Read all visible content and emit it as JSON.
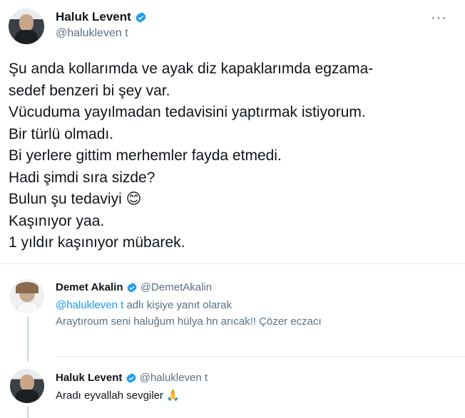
{
  "main_tweet": {
    "display_name": "Haluk Levent",
    "handle": "@halukleven t",
    "lines": [
      "Şu anda kollarımda ve ayak diz kapaklarımda egzama-",
      "sedef benzeri bi şey var.",
      "Vücuduma yayılmadan tedavisini yaptırmak istiyorum.",
      "Bir türlü olmadı.",
      "Bi yerlere gittim merhemler fayda etmedi.",
      "Hadi şimdi sıra sizde?",
      "Bulun şu tedaviyi",
      "Kaşınıyor yaa.",
      "1 yıldır kaşınıyor mübarek."
    ],
    "emoji": "😊"
  },
  "reply1": {
    "display_name": "Demet Akalin",
    "handle": "@DemetAkalin",
    "reply_to_handle": "@halukleven t",
    "reply_to_suffix": "adlı kişiye yanıt olarak",
    "text": "Araytıroum seni haluğum hülya hn arıcak!! Çözer eczacı"
  },
  "reply2": {
    "display_name": "Haluk Levent",
    "handle": "@halukleven t",
    "text": "Aradı eyvallah sevgiler",
    "emoji": "🙏"
  },
  "colors": {
    "verified": "#1d9bf0",
    "link": "#1d9bf0",
    "muted": "#5b7083"
  },
  "icons": {
    "verified": "verified-badge-icon",
    "more": "more-icon"
  }
}
